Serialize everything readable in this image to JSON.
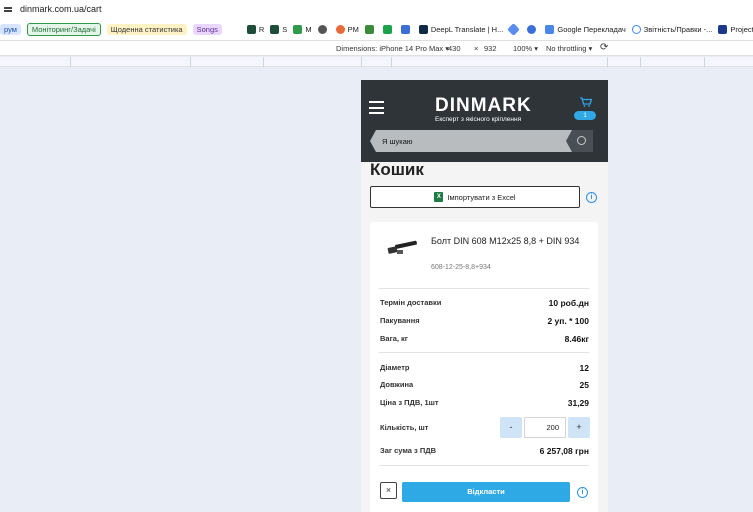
{
  "browser": {
    "url": "dinmark.com.ua/cart"
  },
  "bookmarks": [
    {
      "label": "рум",
      "style": "blue"
    },
    {
      "label": "Моніторинг/Задачі",
      "style": "green"
    },
    {
      "label": "Щоденна статистика",
      "style": "yellow"
    },
    {
      "label": "Songs",
      "style": "purple"
    },
    {
      "label": "R"
    },
    {
      "label": "S"
    },
    {
      "label": "M"
    },
    {
      "label": "PM"
    },
    {
      "label": "DeepL Translate | H..."
    },
    {
      "label": "Google Перекладач"
    },
    {
      "label": "Звітність/Правки -..."
    },
    {
      "label": "Project"
    }
  ],
  "devtools": {
    "dimensions_label": "Dimensions: iPhone 14 Pro Max",
    "width": "430",
    "times": "×",
    "height": "932",
    "zoom": "100%",
    "throttling": "No throttling"
  },
  "site": {
    "logo": "DINMARK",
    "tagline": "Експерт з якісного кріплення",
    "cart_count": "1",
    "search_placeholder": "Я шукаю",
    "page_title": "Кошик",
    "import_button": "Імпортувати з Excel",
    "excel_icon_letter": "X"
  },
  "cart_item": {
    "name": "Болт DIN 608 M12x25 8,8 + DIN 934",
    "sku": "608-12-25-8,8+934",
    "delivery_label": "Термін доставки",
    "delivery_value": "10 роб.дн",
    "packing_label": "Пакування",
    "packing_value": "2 уп. * 100",
    "weight_label": "Вага, кг",
    "weight_value": "8.46кг",
    "diameter_label": "Діаметр",
    "diameter_value": "12",
    "length_label": "Довжина",
    "length_value": "25",
    "price_label": "Ціна з ПДВ, 1шт",
    "price_value": "31,29",
    "qty_label": "Кількість, шт",
    "qty_value": "200",
    "minus": "-",
    "plus": "+",
    "total_label": "Заг сума з ПДВ",
    "total_value": "6 257,08 грн",
    "remove": "×",
    "defer_button": "Відкласти"
  },
  "colors": {
    "header_bg": "#2f3439",
    "accent_blue": "#2fa8e6",
    "stepper_bg": "#cfe4f6"
  }
}
